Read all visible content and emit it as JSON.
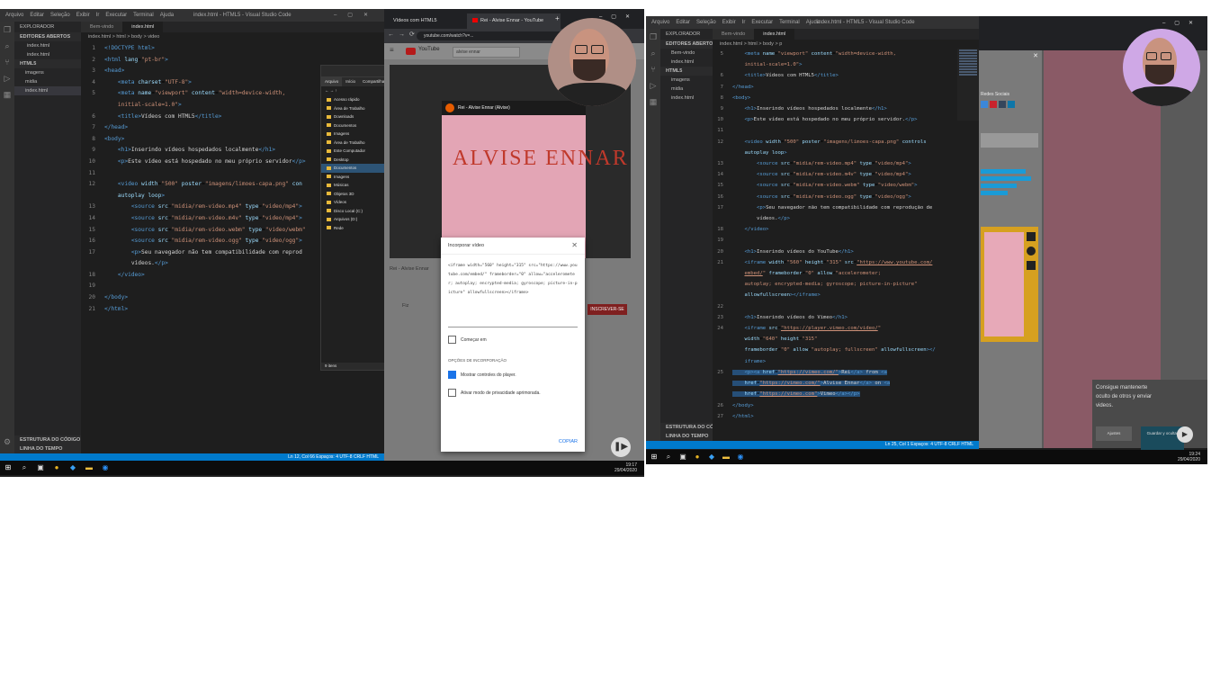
{
  "left": {
    "vscode": {
      "menu": [
        "Arquivo",
        "Editar",
        "Seleção",
        "Exibir",
        "Ir",
        "Executar",
        "Terminal",
        "Ajuda"
      ],
      "window_title": "index.html - HTML5 - Visual Studio Code",
      "explorer": {
        "title": "EXPLORADOR",
        "open_editors_header": "EDITORES ABERTOS",
        "open_editors": [
          "index.html",
          "index.html"
        ],
        "folder_header": "HTML5",
        "tree": [
          "imagens",
          "midia",
          "index.html"
        ],
        "outline": "ESTRUTURA DO CÓDIGO",
        "timeline": "LINHA DO TEMPO"
      },
      "tabs": [
        "Bem-vindo",
        "index.html"
      ],
      "breadcrumb": "index.html > html > body > video",
      "code_lines": [
        {
          "n": "1",
          "h": "<span class='tok-tag'>&lt;!DOCTYPE html&gt;</span>"
        },
        {
          "n": "2",
          "h": "<span class='tok-tag'>&lt;html</span> <span class='tok-at'>lang</span>=<span class='tok-str'>\"pt-br\"</span><span class='tok-tag'>&gt;</span>"
        },
        {
          "n": "3",
          "h": "<span class='tok-tag'>&lt;head&gt;</span>"
        },
        {
          "n": "4",
          "h": "    <span class='tok-tag'>&lt;meta</span> <span class='tok-at'>charset</span>=<span class='tok-str'>\"UTF-8\"</span><span class='tok-tag'>&gt;</span>"
        },
        {
          "n": "5",
          "h": "    <span class='tok-tag'>&lt;meta</span> <span class='tok-at'>name</span>=<span class='tok-str'>\"viewport\"</span> <span class='tok-at'>content</span>=<span class='tok-str'>\"width=device-width,</span>"
        },
        {
          "n": "",
          "h": "    <span class='tok-str'>initial-scale=1.0\"</span><span class='tok-tag'>&gt;</span>"
        },
        {
          "n": "6",
          "h": "    <span class='tok-tag'>&lt;title&gt;</span><span class='tok-txt'>Vídeos com HTML5</span><span class='tok-tag'>&lt;/title&gt;</span>"
        },
        {
          "n": "7",
          "h": "<span class='tok-tag'>&lt;/head&gt;</span>"
        },
        {
          "n": "8",
          "h": "<span class='tok-tag'>&lt;body&gt;</span>"
        },
        {
          "n": "9",
          "h": "    <span class='tok-tag'>&lt;h1&gt;</span><span class='tok-txt'>Inserindo vídeos hospedados localmente</span><span class='tok-tag'>&lt;/h1&gt;</span>"
        },
        {
          "n": "10",
          "h": "    <span class='tok-tag'>&lt;p&gt;</span><span class='tok-txt'>Este vídeo está hospedado no meu próprio servidor</span><span class='tok-tag'>&lt;/p&gt;</span>"
        },
        {
          "n": "11",
          "h": ""
        },
        {
          "n": "12",
          "h": "    <span class='tok-tag'>&lt;video</span> <span class='tok-at'>width</span>=<span class='tok-str'>\"500\"</span> <span class='tok-at'>poster</span>=<span class='tok-str'>\"imagens/limoes-capa.png\"</span> <span class='tok-at'>con</span>"
        },
        {
          "n": "",
          "h": "    <span class='tok-at'>autoplay</span> <span class='tok-at'>loop</span><span class='tok-tag'>&gt;</span>"
        },
        {
          "n": "13",
          "h": "        <span class='tok-tag'>&lt;source</span> <span class='tok-at'>src</span>=<span class='tok-str'>\"midia/rem-video.mp4\"</span> <span class='tok-at'>type</span>=<span class='tok-str'>\"video/mp4\"</span><span class='tok-tag'>&gt;</span>"
        },
        {
          "n": "14",
          "h": "        <span class='tok-tag'>&lt;source</span> <span class='tok-at'>src</span>=<span class='tok-str'>\"midia/rem-video.m4v\"</span> <span class='tok-at'>type</span>=<span class='tok-str'>\"video/mp4\"</span><span class='tok-tag'>&gt;</span>"
        },
        {
          "n": "15",
          "h": "        <span class='tok-tag'>&lt;source</span> <span class='tok-at'>src</span>=<span class='tok-str'>\"midia/rem-video.webm\"</span> <span class='tok-at'>type</span>=<span class='tok-str'>\"video/webm\"</span>"
        },
        {
          "n": "16",
          "h": "        <span class='tok-tag'>&lt;source</span> <span class='tok-at'>src</span>=<span class='tok-str'>\"midia/rem-video.ogg\"</span> <span class='tok-at'>type</span>=<span class='tok-str'>\"video/ogg\"</span><span class='tok-tag'>&gt;</span>"
        },
        {
          "n": "17",
          "h": "        <span class='tok-tag'>&lt;p&gt;</span><span class='tok-txt'>Seu navegador não tem compatibilidade com reprod</span>"
        },
        {
          "n": "",
          "h": "        <span class='tok-txt'>vídeos.</span><span class='tok-tag'>&lt;/p&gt;</span>"
        },
        {
          "n": "18",
          "h": "    <span class='tok-tag'>&lt;/video&gt;</span>"
        },
        {
          "n": "19",
          "h": ""
        },
        {
          "n": "20",
          "h": "<span class='tok-tag'>&lt;/body&gt;</span>"
        },
        {
          "n": "21",
          "h": "<span class='tok-tag'>&lt;/html&gt;</span>"
        }
      ],
      "status_right": "Ln 12, Col 66   Espaços: 4   UTF-8   CRLF   HTML"
    },
    "file_picker": {
      "tabs": [
        "Arquivo",
        "Início",
        "Compartilhar"
      ],
      "items": [
        "Acesso rápido",
        "Área de Trabalho",
        "Downloads",
        "Documentos",
        "Imagens",
        "Área de Trabalho",
        "Este Computador",
        "Desktop",
        "Documentos",
        "Imagens",
        "Músicas",
        "Objetos 3D",
        "Vídeos",
        "Disco Local (C:)",
        "Arquivos (D:)",
        "Rede"
      ],
      "selected_index": 8,
      "footer": "9 itens"
    },
    "chrome": {
      "tabs": [
        "Vídeos com HTML5",
        "Rei - Alvise Ennar - YouTube"
      ],
      "url": "youtube.com/watch?v=...",
      "yt_search": "alvise ennar",
      "video_title": "Rei - Alvise Ennar (Alvise)",
      "thumb_text": "ALVISE ENNAR",
      "info_title": "Rei - Alvise Ennar",
      "channel": "Fiz",
      "subscribe": "INSCREVER-SE",
      "dialog": {
        "title": "Incorporar vídeo",
        "embed_code": "<iframe width=\"560\" height=\"315\" src=\"https://www.youtube.com/embed/\" frameborder=\"0\" allow=\"accelerometer; autoplay; encrypted-media; gyroscope; picture-in-picture\" allowfullscreen></iframe>",
        "start_label": "Começar em",
        "options_header": "OPÇÕES DE INCORPORAÇÃO",
        "opt1": "Mostrar controles do player.",
        "opt2": "Ativar modo de privacidade aprimorada.",
        "copy": "COPIAR"
      }
    },
    "taskbar": {
      "time": "19:17",
      "date": "29/04/2020"
    }
  },
  "right": {
    "vscode": {
      "menu": [
        "Arquivo",
        "Editar",
        "Seleção",
        "Exibir",
        "Ir",
        "Executar",
        "Terminal",
        "Ajuda"
      ],
      "window_title": "index.html - HTML5 - Visual Studio Code",
      "explorer": {
        "title": "EXPLORADOR",
        "open_editors_header": "EDITORES ABERTOS",
        "open_editors": [
          "Bem-vindo",
          "index.html"
        ],
        "folder_header": "HTML5",
        "tree": [
          "imagens",
          "midia",
          "index.html"
        ],
        "outline": "ESTRUTURA DO CÓDIGO",
        "timeline": "LINHA DO TEMPO"
      },
      "tabs": [
        "Bem-vindo",
        "index.html"
      ],
      "breadcrumb": "index.html > html > body > p",
      "code_lines": [
        {
          "n": "5",
          "h": "    <span class='tok-tag'>&lt;meta</span> <span class='tok-at'>name</span>=<span class='tok-str'>\"viewport\"</span> <span class='tok-at'>content</span>=<span class='tok-str'>\"width=device-width,</span>"
        },
        {
          "n": "",
          "h": "    <span class='tok-str'>initial-scale=1.0\"</span><span class='tok-tag'>&gt;</span>"
        },
        {
          "n": "6",
          "h": "    <span class='tok-tag'>&lt;title&gt;</span><span class='tok-txt'>Vídeos com HTML5</span><span class='tok-tag'>&lt;/title&gt;</span>"
        },
        {
          "n": "7",
          "h": "<span class='tok-tag'>&lt;/head&gt;</span>"
        },
        {
          "n": "8",
          "h": "<span class='tok-tag'>&lt;body&gt;</span>"
        },
        {
          "n": "9",
          "h": "    <span class='tok-tag'>&lt;h1&gt;</span><span class='tok-txt'>Inserindo vídeos hospedados localmente</span><span class='tok-tag'>&lt;/h1&gt;</span>"
        },
        {
          "n": "10",
          "h": "    <span class='tok-tag'>&lt;p&gt;</span><span class='tok-txt'>Este vídeo está hospedado no meu próprio servidor.</span><span class='tok-tag'>&lt;/p&gt;</span>"
        },
        {
          "n": "11",
          "h": ""
        },
        {
          "n": "12",
          "h": "    <span class='tok-tag'>&lt;video</span> <span class='tok-at'>width</span>=<span class='tok-str'>\"500\"</span> <span class='tok-at'>poster</span>=<span class='tok-str'>\"imagens/limoes-capa.png\"</span> <span class='tok-at'>controls</span>"
        },
        {
          "n": "",
          "h": "    <span class='tok-at'>autoplay</span> <span class='tok-at'>loop</span><span class='tok-tag'>&gt;</span>"
        },
        {
          "n": "13",
          "h": "        <span class='tok-tag'>&lt;source</span> <span class='tok-at'>src</span>=<span class='tok-str'>\"midia/rem-video.mp4\"</span> <span class='tok-at'>type</span>=<span class='tok-str'>\"video/mp4\"</span><span class='tok-tag'>&gt;</span>"
        },
        {
          "n": "14",
          "h": "        <span class='tok-tag'>&lt;source</span> <span class='tok-at'>src</span>=<span class='tok-str'>\"midia/rem-video.m4v\"</span> <span class='tok-at'>type</span>=<span class='tok-str'>\"video/mp4\"</span><span class='tok-tag'>&gt;</span>"
        },
        {
          "n": "15",
          "h": "        <span class='tok-tag'>&lt;source</span> <span class='tok-at'>src</span>=<span class='tok-str'>\"midia/rem-video.webm\"</span> <span class='tok-at'>type</span>=<span class='tok-str'>\"video/webm\"</span><span class='tok-tag'>&gt;</span>"
        },
        {
          "n": "16",
          "h": "        <span class='tok-tag'>&lt;source</span> <span class='tok-at'>src</span>=<span class='tok-str'>\"midia/rem-video.ogg\"</span> <span class='tok-at'>type</span>=<span class='tok-str'>\"video/ogg\"</span><span class='tok-tag'>&gt;</span>"
        },
        {
          "n": "17",
          "h": "        <span class='tok-tag'>&lt;p&gt;</span><span class='tok-txt'>Seu navegador não tem compatibilidade com reprodução de</span>"
        },
        {
          "n": "",
          "h": "        <span class='tok-txt'>vídeos.</span><span class='tok-tag'>&lt;/p&gt;</span>"
        },
        {
          "n": "18",
          "h": "    <span class='tok-tag'>&lt;/video&gt;</span>"
        },
        {
          "n": "19",
          "h": ""
        },
        {
          "n": "20",
          "h": "    <span class='tok-tag'>&lt;h1&gt;</span><span class='tok-txt'>Inserindo vídeos do YouTube</span><span class='tok-tag'>&lt;/h1&gt;</span>"
        },
        {
          "n": "21",
          "h": "    <span class='tok-tag'>&lt;iframe</span> <span class='tok-at'>width</span>=<span class='tok-str'>\"560\"</span> <span class='tok-at'>height</span>=<span class='tok-str'>\"315\"</span> <span class='tok-at'>src</span>=<span class='tok-url'>\"https://www.youtube.com/</span>"
        },
        {
          "n": "",
          "h": "    <span class='tok-url'>embed/</span><span class='tok-str'>\"</span> <span class='tok-at'>frameborder</span>=<span class='tok-str'>\"0\"</span> <span class='tok-at'>allow</span>=<span class='tok-str'>\"accelerometer;</span>"
        },
        {
          "n": "",
          "h": "    <span class='tok-str'>autoplay; encrypted-media; gyroscope; picture-in-picture\"</span>"
        },
        {
          "n": "",
          "h": "    <span class='tok-at'>allowfullscreen</span><span class='tok-tag'>&gt;&lt;/iframe&gt;</span>"
        },
        {
          "n": "22",
          "h": ""
        },
        {
          "n": "23",
          "h": "    <span class='tok-tag'>&lt;h1&gt;</span><span class='tok-txt'>Inserindo vídeos do Vimeo</span><span class='tok-tag'>&lt;/h1&gt;</span>"
        },
        {
          "n": "24",
          "h": "    <span class='tok-tag'>&lt;iframe</span> <span class='tok-at'>src</span>=<span class='tok-url'>\"https://player.vimeo.com/video/</span><span class='tok-str'>\"</span>"
        },
        {
          "n": "",
          "h": "    <span class='tok-at'>width</span>=<span class='tok-str'>\"640\"</span> <span class='tok-at'>height</span>=<span class='tok-str'>\"315\"</span>"
        },
        {
          "n": "",
          "h": "    <span class='tok-at'>frameborder</span>=<span class='tok-str'>\"0\"</span> <span class='tok-at'>allow</span>=<span class='tok-str'>\"autoplay; fullscreen\"</span> <span class='tok-at'>allowfullscreen</span><span class='tok-tag'>&gt;&lt;/</span>"
        },
        {
          "n": "",
          "h": "    <span class='tok-tag'>iframe&gt;</span>"
        },
        {
          "n": "25",
          "h": "<span class='hl'>    <span class='tok-tag'>&lt;p&gt;&lt;a</span> <span class='tok-at'>href</span>=<span class='tok-url'>\"https://vimeo.com/\"</span><span class='tok-tag'>&gt;</span><span class='tok-txt'>Rei</span><span class='tok-tag'>&lt;/a&gt;</span> <span class='tok-txt'>from</span> <span class='tok-tag'>&lt;a</span></span>"
        },
        {
          "n": "",
          "h": "<span class='hl'>    <span class='tok-at'>href</span>=<span class='tok-url'>\"https://vimeo.com/\"</span><span class='tok-tag'>&gt;</span><span class='tok-txt'>Alvise Ennar</span><span class='tok-tag'>&lt;/a&gt;</span> <span class='tok-txt'>on</span> <span class='tok-tag'>&lt;a</span></span>"
        },
        {
          "n": "",
          "h": "<span class='hl'>    <span class='tok-at'>href</span>=<span class='tok-url'>\"https://vimeo.com\"</span><span class='tok-tag'>&gt;</span><span class='tok-txt'>Vimeo</span><span class='tok-tag'>&lt;/a&gt;&lt;/p&gt;</span></span>"
        },
        {
          "n": "26",
          "h": "<span class='tok-tag'>&lt;/body&gt;</span>"
        },
        {
          "n": "27",
          "h": "<span class='tok-tag'>&lt;/html&gt;</span>"
        }
      ],
      "status_right": "Ln 25, Col 1   Espaços: 4   UTF-8   CRLF   HTML"
    },
    "vimeo_page": {
      "share_title": "Redes Sociais",
      "cookie_text": "Consigue mantenerte oculto de otros y enviar videos.",
      "btn1": "Ajustes",
      "btn2": "Guardar y ocultar",
      "link": "Rei"
    },
    "taskbar": {
      "time": "19:24",
      "date": "29/04/2020"
    }
  }
}
